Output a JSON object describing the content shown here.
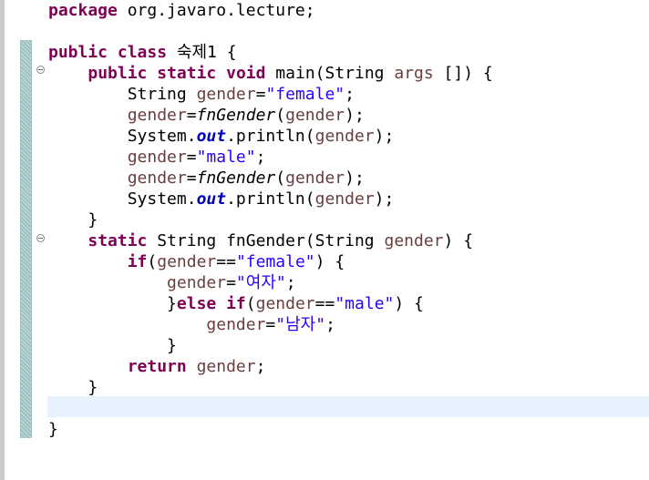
{
  "editor": {
    "lines": [
      [
        {
          "t": "package",
          "c": "kw"
        },
        {
          "t": " org.javaro.lecture;",
          "c": ""
        }
      ],
      [],
      [
        {
          "t": "public",
          "c": "kw"
        },
        {
          "t": " ",
          "c": ""
        },
        {
          "t": "class",
          "c": "kw"
        },
        {
          "t": " 숙제1 {",
          "c": ""
        }
      ],
      [
        {
          "t": "    ",
          "c": ""
        },
        {
          "t": "public",
          "c": "kw"
        },
        {
          "t": " ",
          "c": ""
        },
        {
          "t": "static",
          "c": "kw"
        },
        {
          "t": " ",
          "c": ""
        },
        {
          "t": "void",
          "c": "kw"
        },
        {
          "t": " main(String ",
          "c": ""
        },
        {
          "t": "args",
          "c": "var"
        },
        {
          "t": " []) {",
          "c": ""
        }
      ],
      [
        {
          "t": "        String ",
          "c": ""
        },
        {
          "t": "gender",
          "c": "var"
        },
        {
          "t": "=",
          "c": ""
        },
        {
          "t": "\"female\"",
          "c": "str"
        },
        {
          "t": ";",
          "c": ""
        }
      ],
      [
        {
          "t": "        ",
          "c": ""
        },
        {
          "t": "gender",
          "c": "var"
        },
        {
          "t": "=",
          "c": ""
        },
        {
          "t": "fnGender",
          "c": "it"
        },
        {
          "t": "(",
          "c": ""
        },
        {
          "t": "gender",
          "c": "var"
        },
        {
          "t": ");",
          "c": ""
        }
      ],
      [
        {
          "t": "        System.",
          "c": ""
        },
        {
          "t": "out",
          "c": "fld"
        },
        {
          "t": ".println(",
          "c": ""
        },
        {
          "t": "gender",
          "c": "var"
        },
        {
          "t": ");",
          "c": ""
        }
      ],
      [
        {
          "t": "        ",
          "c": ""
        },
        {
          "t": "gender",
          "c": "var"
        },
        {
          "t": "=",
          "c": ""
        },
        {
          "t": "\"male\"",
          "c": "str"
        },
        {
          "t": ";",
          "c": ""
        }
      ],
      [
        {
          "t": "        ",
          "c": ""
        },
        {
          "t": "gender",
          "c": "var"
        },
        {
          "t": "=",
          "c": ""
        },
        {
          "t": "fnGender",
          "c": "it"
        },
        {
          "t": "(",
          "c": ""
        },
        {
          "t": "gender",
          "c": "var"
        },
        {
          "t": ");",
          "c": ""
        }
      ],
      [
        {
          "t": "        System.",
          "c": ""
        },
        {
          "t": "out",
          "c": "fld"
        },
        {
          "t": ".println(",
          "c": ""
        },
        {
          "t": "gender",
          "c": "var"
        },
        {
          "t": ");",
          "c": ""
        }
      ],
      [
        {
          "t": "    }",
          "c": ""
        }
      ],
      [
        {
          "t": "    ",
          "c": ""
        },
        {
          "t": "static",
          "c": "kw"
        },
        {
          "t": " String fnGender(String ",
          "c": ""
        },
        {
          "t": "gender",
          "c": "var"
        },
        {
          "t": ") {",
          "c": ""
        }
      ],
      [
        {
          "t": "        ",
          "c": ""
        },
        {
          "t": "if",
          "c": "kw"
        },
        {
          "t": "(",
          "c": ""
        },
        {
          "t": "gender",
          "c": "var"
        },
        {
          "t": "==",
          "c": ""
        },
        {
          "t": "\"female\"",
          "c": "str"
        },
        {
          "t": ") {",
          "c": ""
        }
      ],
      [
        {
          "t": "            ",
          "c": ""
        },
        {
          "t": "gender",
          "c": "var"
        },
        {
          "t": "=",
          "c": ""
        },
        {
          "t": "\"여자\"",
          "c": "str"
        },
        {
          "t": ";",
          "c": ""
        }
      ],
      [
        {
          "t": "            }",
          "c": ""
        },
        {
          "t": "else",
          "c": "kw"
        },
        {
          "t": " ",
          "c": ""
        },
        {
          "t": "if",
          "c": "kw"
        },
        {
          "t": "(",
          "c": ""
        },
        {
          "t": "gender",
          "c": "var"
        },
        {
          "t": "==",
          "c": ""
        },
        {
          "t": "\"male\"",
          "c": "str"
        },
        {
          "t": ") {",
          "c": ""
        }
      ],
      [
        {
          "t": "                ",
          "c": ""
        },
        {
          "t": "gender",
          "c": "var"
        },
        {
          "t": "=",
          "c": ""
        },
        {
          "t": "\"남자\"",
          "c": "str"
        },
        {
          "t": ";",
          "c": ""
        }
      ],
      [
        {
          "t": "            }",
          "c": ""
        }
      ],
      [
        {
          "t": "        ",
          "c": ""
        },
        {
          "t": "return",
          "c": "kw"
        },
        {
          "t": " ",
          "c": ""
        },
        {
          "t": "gender",
          "c": "var"
        },
        {
          "t": ";",
          "c": ""
        }
      ],
      [
        {
          "t": "    }",
          "c": ""
        }
      ],
      [],
      [
        {
          "t": "}",
          "c": ""
        }
      ]
    ]
  },
  "colors": {
    "keyword": "#7f0055",
    "string": "#2a00ff",
    "local_variable": "#6a3e3e",
    "static_field": "#0000c0",
    "current_line_highlight": "#e8f2fe"
  },
  "icons": {
    "fold_main": "collapse-minus-icon",
    "fold_fngender": "collapse-minus-icon"
  }
}
